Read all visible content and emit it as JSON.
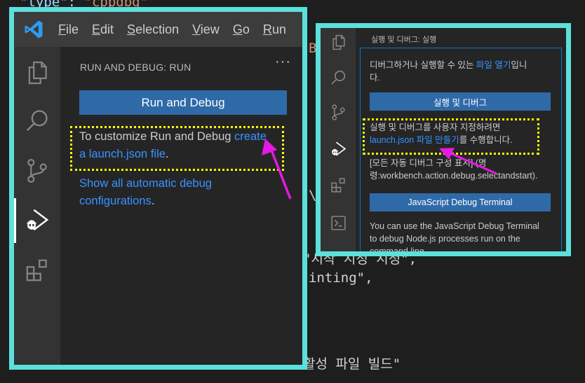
{
  "background_code": {
    "line1_key": "\"type\": ",
    "line1_val": "\"cppdbg\"",
    "frag_b": "B",
    "frag_backslash": "\\",
    "line_korean_1": "\"시작 시정 시정\",",
    "line_printing": "inting\",",
    "line_korean_2": "활성 파일 빌드\""
  },
  "left_panel": {
    "menu": [
      "File",
      "Edit",
      "Selection",
      "View",
      "Go",
      "Run"
    ],
    "sidebar_title": "RUN AND DEBUG: RUN",
    "more_label": "···",
    "run_button": "Run and Debug",
    "customize_text_1": "To customize Run and Debug ",
    "customize_link_1": "create",
    "customize_link_2": "a launch.json file",
    "customize_text_2": ".",
    "show_all_link_1": "Show all automatic debug",
    "show_all_link_2": "configurations",
    "show_all_tail": "."
  },
  "right_panel": {
    "sidebar_title": "실행 및 디버그: 실행",
    "intro_text_1": "디버그하거나 실행할 수 있는 ",
    "intro_link": "파일 열기",
    "intro_text_2": "입니",
    "intro_text_3": "다.",
    "run_button": "실행 및 디버그",
    "customize_text_1": "실행 및 디버그를 사용자 지정하려면",
    "customize_link": "launch.json 파일 만들기",
    "customize_text_2": "를 수행합니다.",
    "show_all_1": "[모든 자동 디버그 구성 표시] (명",
    "show_all_2": "령:workbench.action.debug.selectandstart).",
    "js_terminal_button": "JavaScript Debug Terminal",
    "js_text_1": "You can use the JavaScript Debug Terminal",
    "js_text_2": "to debug Node.js processes run on the",
    "js_text_3": "command line."
  },
  "colors": {
    "highlight_border": "#5ce0dc",
    "annotation_box": "#ffff00",
    "arrow": "#e619e0",
    "button": "#2f6aa8",
    "link": "#3794ff"
  },
  "icons": [
    "vscode-logo-icon",
    "explorer-icon",
    "search-icon",
    "source-control-icon",
    "run-debug-icon",
    "extensions-icon",
    "terminal-icon"
  ]
}
